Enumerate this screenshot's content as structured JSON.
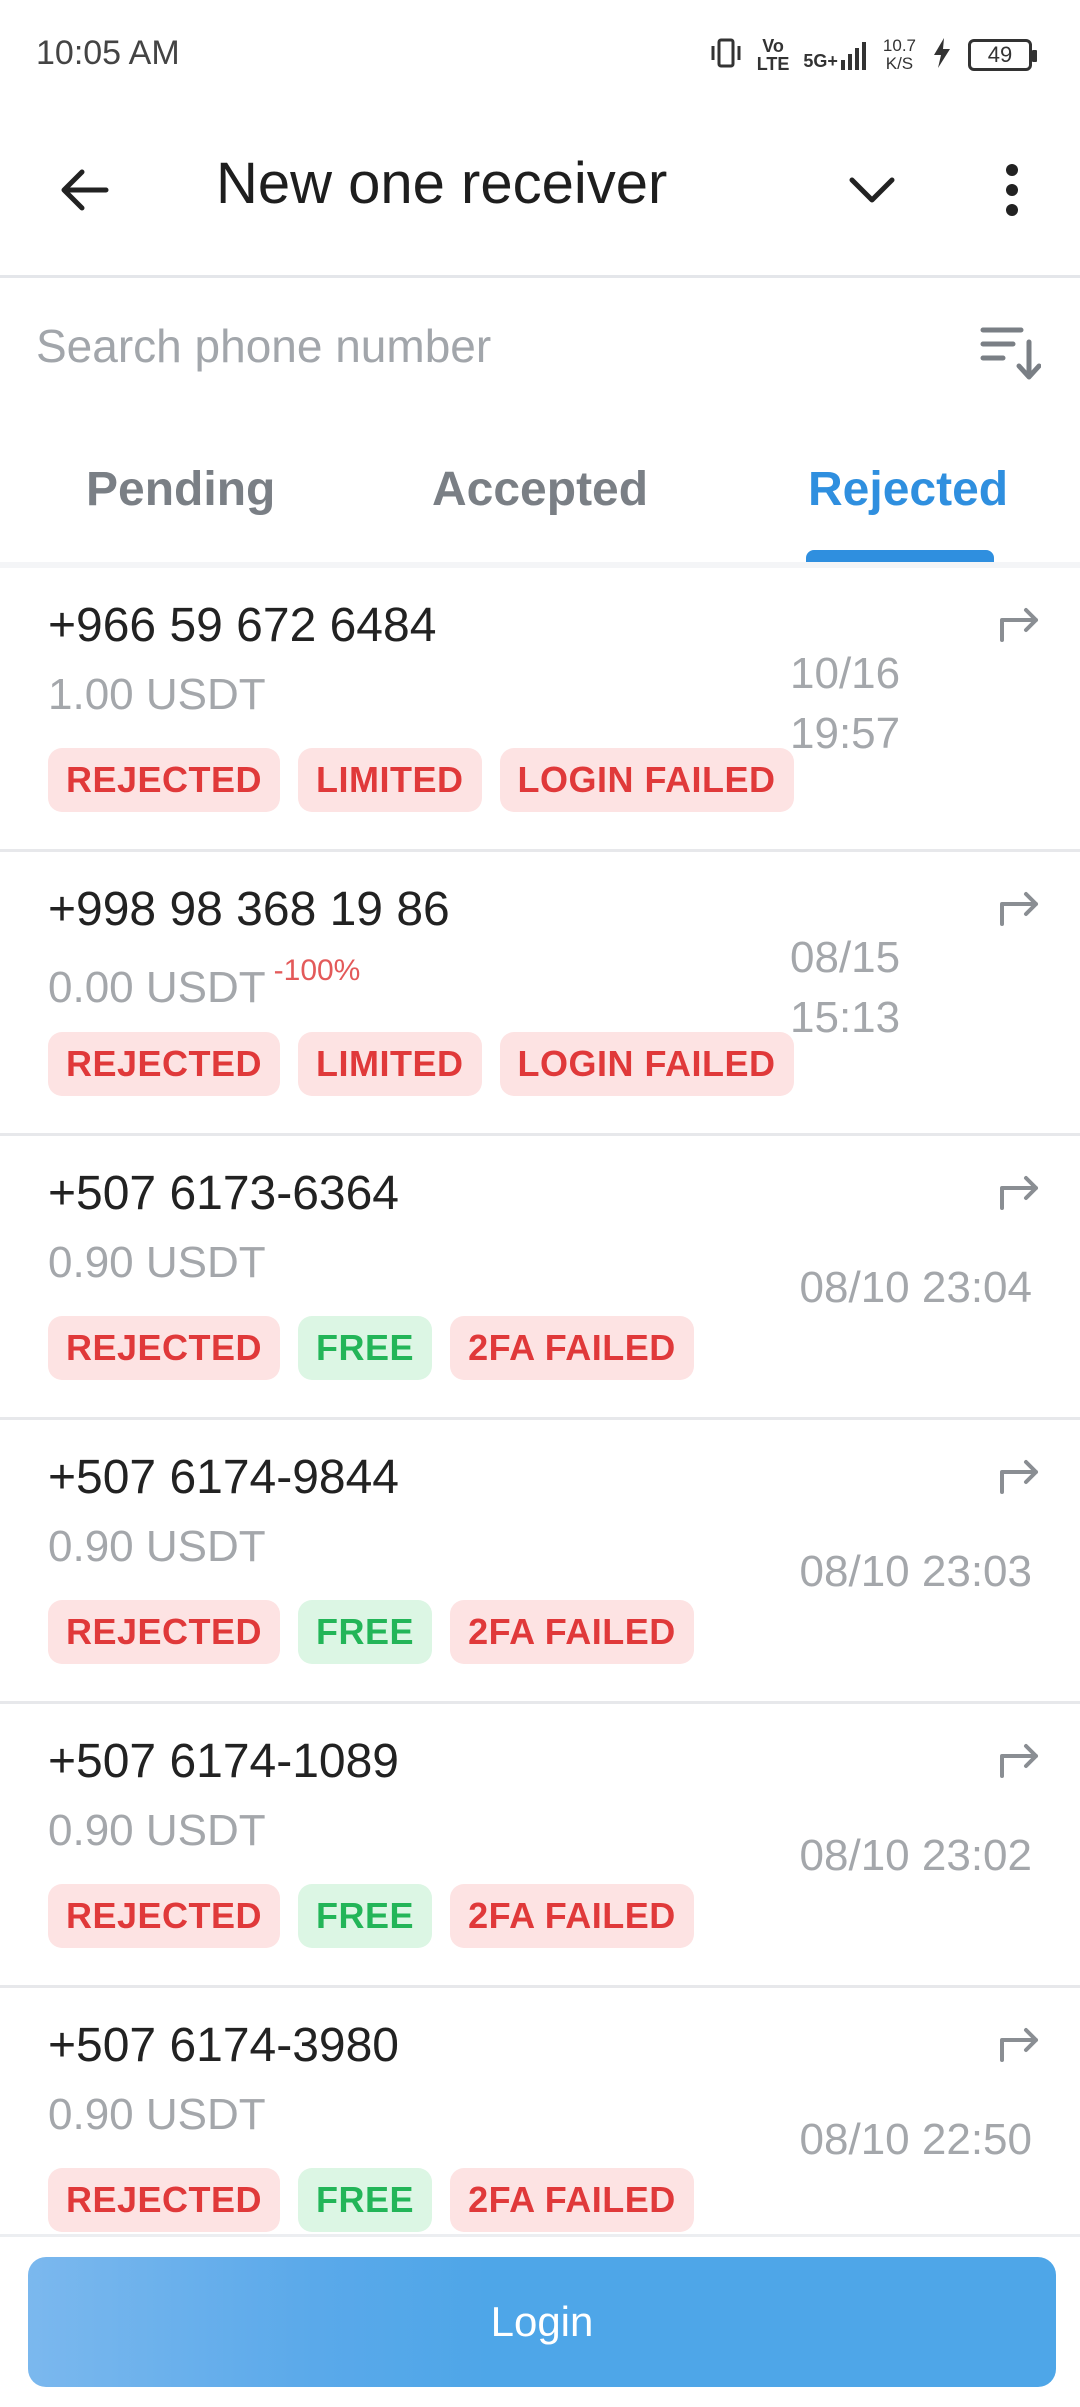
{
  "status_bar": {
    "time": "10:05 AM",
    "network_vo": "Vo",
    "network_lte": "LTE",
    "network_5g": "5G+",
    "speed_value": "10.7",
    "speed_unit": "K/S",
    "battery": "49",
    "icons": [
      "vibrate-icon",
      "signal-icon",
      "charging-icon",
      "battery-icon"
    ]
  },
  "app_bar": {
    "title": "New one receiver",
    "icons": [
      "back-arrow-icon",
      "chevron-down-icon",
      "more-vert-icon"
    ]
  },
  "search": {
    "placeholder": "Search phone number",
    "sort_icon": "sort-descending-icon"
  },
  "tabs": [
    {
      "label": "Pending",
      "active": false
    },
    {
      "label": "Accepted",
      "active": false
    },
    {
      "label": "Rejected",
      "active": true
    }
  ],
  "receivers": [
    {
      "phone": "+966 59 672 6484",
      "amount": "1.00 USDT",
      "change": "",
      "date_line1": "10/16",
      "date_line2": "19:57",
      "badges": [
        {
          "label": "REJECTED",
          "tone": "red"
        },
        {
          "label": "LIMITED",
          "tone": "red"
        },
        {
          "label": "LOGIN FAILED",
          "tone": "red"
        }
      ]
    },
    {
      "phone": "+998 98 368 19 86",
      "amount": "0.00 USDT",
      "change": "-100%",
      "date_line1": "08/15",
      "date_line2": "15:13",
      "badges": [
        {
          "label": "REJECTED",
          "tone": "red"
        },
        {
          "label": "LIMITED",
          "tone": "red"
        },
        {
          "label": "LOGIN FAILED",
          "tone": "red"
        }
      ]
    },
    {
      "phone": "+507 6173-6364",
      "amount": "0.90 USDT",
      "change": "",
      "date": "08/10 23:04",
      "badges": [
        {
          "label": "REJECTED",
          "tone": "red"
        },
        {
          "label": "FREE",
          "tone": "green"
        },
        {
          "label": "2FA FAILED",
          "tone": "red"
        }
      ]
    },
    {
      "phone": "+507 6174-9844",
      "amount": "0.90 USDT",
      "change": "",
      "date": "08/10 23:03",
      "badges": [
        {
          "label": "REJECTED",
          "tone": "red"
        },
        {
          "label": "FREE",
          "tone": "green"
        },
        {
          "label": "2FA FAILED",
          "tone": "red"
        }
      ]
    },
    {
      "phone": "+507 6174-1089",
      "amount": "0.90 USDT",
      "change": "",
      "date": "08/10 23:02",
      "badges": [
        {
          "label": "REJECTED",
          "tone": "red"
        },
        {
          "label": "FREE",
          "tone": "green"
        },
        {
          "label": "2FA FAILED",
          "tone": "red"
        }
      ]
    },
    {
      "phone": "+507 6174-3980",
      "amount": "0.90 USDT",
      "change": "",
      "date": "08/10 22:50",
      "badges": [
        {
          "label": "REJECTED",
          "tone": "red"
        },
        {
          "label": "FREE",
          "tone": "green"
        },
        {
          "label": "2FA FAILED",
          "tone": "red"
        }
      ]
    }
  ],
  "login_button": {
    "label": "Login"
  },
  "colors": {
    "accent": "#2f8fdf",
    "badge_red_bg": "#fde3e3",
    "badge_red_text": "#e0393a",
    "badge_green_bg": "#dcf6e4",
    "badge_green_text": "#23b558",
    "button": "#4ea6e8"
  }
}
